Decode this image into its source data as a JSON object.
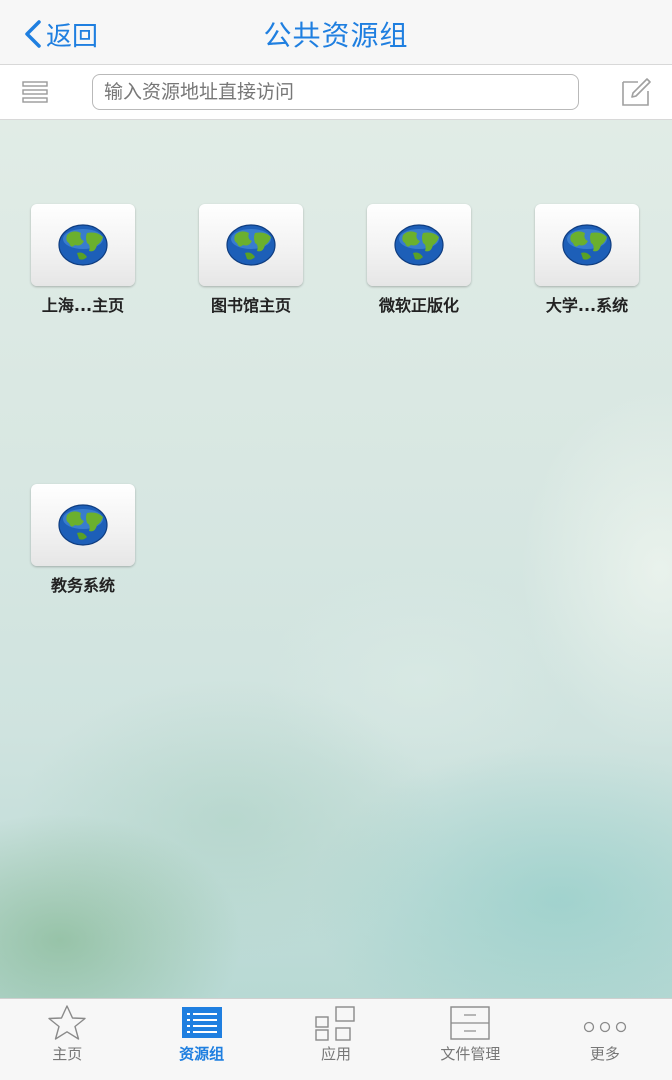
{
  "nav": {
    "back_label": "返回",
    "title": "公共资源组"
  },
  "toolbar": {
    "url_placeholder": "输入资源地址直接访问",
    "url_value": ""
  },
  "resources": [
    {
      "label": "上海...主页",
      "icon": "globe-icon"
    },
    {
      "label": "图书馆主页",
      "icon": "globe-icon"
    },
    {
      "label": "微软正版化",
      "icon": "globe-icon"
    },
    {
      "label": "大学...系统",
      "icon": "globe-icon"
    },
    {
      "label": "教务系统",
      "icon": "globe-icon"
    }
  ],
  "tabs": [
    {
      "label": "主页",
      "icon": "star-icon",
      "active": false
    },
    {
      "label": "资源组",
      "icon": "list-icon",
      "active": true
    },
    {
      "label": "应用",
      "icon": "apps-grid-icon",
      "active": false
    },
    {
      "label": "文件管理",
      "icon": "document-icon",
      "active": false
    },
    {
      "label": "更多",
      "icon": "more-icon",
      "active": false
    }
  ],
  "colors": {
    "accent": "#1f7fe0",
    "inactive": "#777777"
  }
}
